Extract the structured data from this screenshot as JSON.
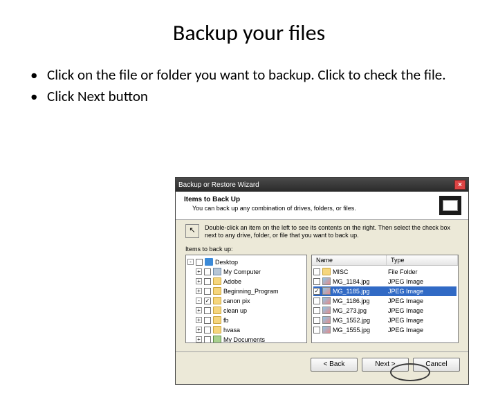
{
  "slide": {
    "title": "Backup your files",
    "bullets": [
      "Click on the file or folder you want to backup. Click to check the file.",
      "Click Next button"
    ]
  },
  "wizard": {
    "title": "Backup or Restore Wizard",
    "header_title": "Items to Back Up",
    "header_sub": "You can back up any combination of drives, folders, or files.",
    "instruction": "Double-click an item on the left to see its contents on the right. Then select the check box next to any drive, folder, or file that you want to back up.",
    "section_label": "Items to back up:",
    "tree": [
      {
        "depth": 0,
        "expander": "-",
        "checked": false,
        "icon": "i-desktop",
        "label": "Desktop"
      },
      {
        "depth": 1,
        "expander": "+",
        "checked": false,
        "icon": "i-computer",
        "label": "My Computer"
      },
      {
        "depth": 1,
        "expander": "+",
        "checked": false,
        "icon": "i-folder",
        "label": "Adobe"
      },
      {
        "depth": 1,
        "expander": "+",
        "checked": false,
        "icon": "i-folder",
        "label": "Beginning_Program"
      },
      {
        "depth": 1,
        "expander": "-",
        "checked": true,
        "icon": "i-folder",
        "label": "canon pix"
      },
      {
        "depth": 1,
        "expander": "+",
        "checked": false,
        "icon": "i-folder",
        "label": "clean up"
      },
      {
        "depth": 1,
        "expander": "+",
        "checked": false,
        "icon": "i-folder",
        "label": "fb"
      },
      {
        "depth": 1,
        "expander": "+",
        "checked": false,
        "icon": "i-folder",
        "label": "hvasa"
      },
      {
        "depth": 1,
        "expander": "+",
        "checked": false,
        "icon": "i-mydocs",
        "label": "My Documents"
      }
    ],
    "columns": {
      "name": "Name",
      "type": "Type"
    },
    "list": [
      {
        "checked": false,
        "icon": "i-folder",
        "name": "MISC",
        "type": "File Folder"
      },
      {
        "checked": false,
        "icon": "i-jpg",
        "name": "MG_1184.jpg",
        "type": "JPEG Image"
      },
      {
        "checked": true,
        "icon": "i-jpg",
        "name": "MG_1185.jpg",
        "type": "JPEG Image",
        "selected": true
      },
      {
        "checked": false,
        "icon": "i-jpg",
        "name": "MG_1186.jpg",
        "type": "JPEG Image"
      },
      {
        "checked": false,
        "icon": "i-jpg",
        "name": "MG_273.jpg",
        "type": "JPEG Image"
      },
      {
        "checked": false,
        "icon": "i-jpg",
        "name": "MG_1552.jpg",
        "type": "JPEG Image"
      },
      {
        "checked": false,
        "icon": "i-jpg",
        "name": "MG_1555.jpg",
        "type": "JPEG Image"
      }
    ],
    "buttons": {
      "back": "< Back",
      "next": "Next >",
      "cancel": "Cancel"
    }
  }
}
